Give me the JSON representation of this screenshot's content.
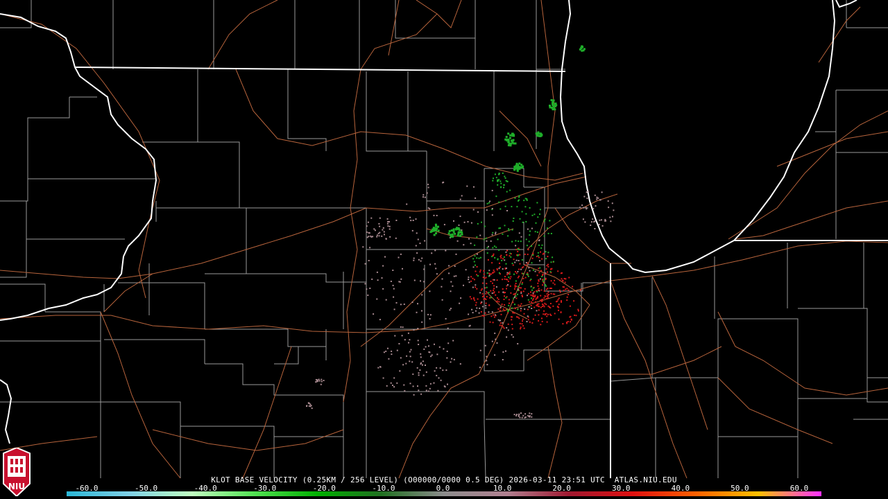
{
  "caption": "KLOT BASE VELOCITY (0.25KM / 256 LEVEL) (O00000/0000 0.5 DEG) 2026-03-11 23:51 UTC  ATLAS.NIU.EDU",
  "logo_text": "NIU",
  "scale": {
    "ticks": [
      "-60.0",
      "-50.0",
      "-40.0",
      "-30.0",
      "-20.0",
      "-10.0",
      "0.0",
      "10.0",
      "20.0",
      "30.0",
      "40.0",
      "50.0",
      "60.0"
    ],
    "colors": [
      "#2ab6d6",
      "#7fd0e6",
      "#c0ffc0",
      "#50e050",
      "#00b000",
      "#207020",
      "#8c8c8c",
      "#b08090",
      "#a01830",
      "#e01010",
      "#ff6000",
      "#ffc000",
      "#ff30ff"
    ]
  },
  "colors": {
    "background": "#000000",
    "state_border": "#ffffff",
    "county_border": "#9a9a9a",
    "roads": "#b8643c",
    "inbound": "#1fae2a",
    "outbound": "#d61a1a",
    "near_zero": "#a88a90"
  }
}
